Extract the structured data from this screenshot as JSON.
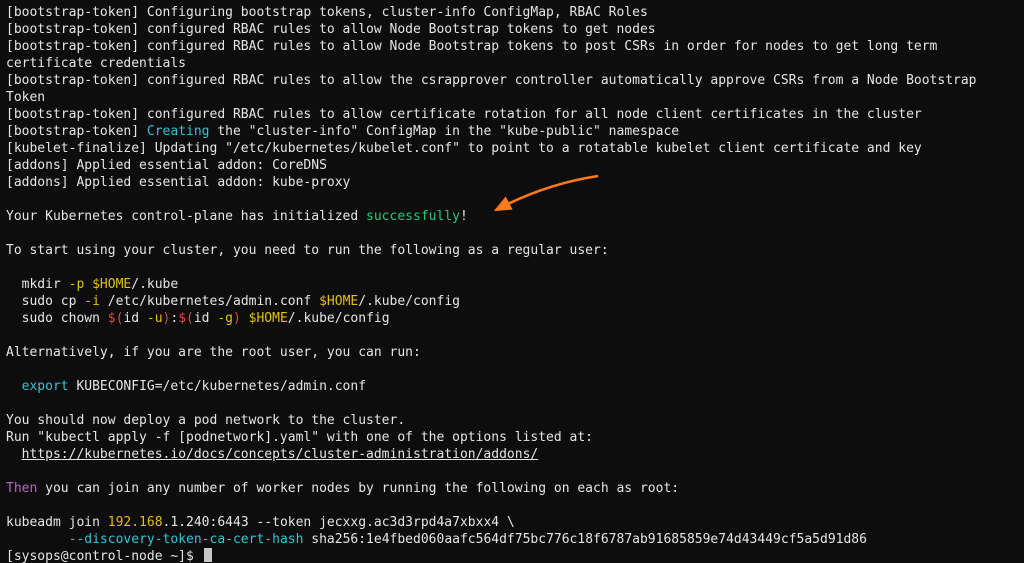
{
  "lines": [
    {
      "segments": [
        {
          "text": "[bootstrap-token] Configuring bootstrap tokens, cluster-info ConfigMap, RBAC Roles",
          "cls": "white"
        }
      ]
    },
    {
      "segments": [
        {
          "text": "[bootstrap-token] configured RBAC rules to allow Node Bootstrap tokens to get nodes",
          "cls": "white"
        }
      ]
    },
    {
      "segments": [
        {
          "text": "[bootstrap-token] configured RBAC rules to allow Node Bootstrap tokens to post CSRs in order for nodes to get long term certificate credentials",
          "cls": "white"
        }
      ]
    },
    {
      "segments": [
        {
          "text": "[bootstrap-token] configured RBAC rules to allow the csrapprover controller automatically approve CSRs from a Node Bootstrap Token",
          "cls": "white"
        }
      ]
    },
    {
      "segments": [
        {
          "text": "[bootstrap-token] configured RBAC rules to allow certificate rotation for all node client certificates in the cluster",
          "cls": "white"
        }
      ]
    },
    {
      "segments": [
        {
          "text": "[bootstrap-token] ",
          "cls": "white"
        },
        {
          "text": "Creating",
          "cls": "cyan"
        },
        {
          "text": " the \"cluster-info\" ConfigMap in the \"kube-public\" namespace",
          "cls": "white"
        }
      ]
    },
    {
      "segments": [
        {
          "text": "[kubelet-finalize] Updating \"/etc/kubernetes/kubelet.conf\" to point to a rotatable kubelet client certificate and key",
          "cls": "white"
        }
      ]
    },
    {
      "segments": [
        {
          "text": "[addons] Applied essential addon: CoreDNS",
          "cls": "white"
        }
      ]
    },
    {
      "segments": [
        {
          "text": "[addons] Applied essential addon: kube-proxy",
          "cls": "white"
        }
      ]
    },
    {
      "blank": true
    },
    {
      "segments": [
        {
          "text": "Your Kubernetes control-plane has initialized ",
          "cls": "white"
        },
        {
          "text": "successfully",
          "cls": "green"
        },
        {
          "text": "!",
          "cls": "white"
        }
      ]
    },
    {
      "blank": true
    },
    {
      "segments": [
        {
          "text": "To start using your cluster, you need to run the following as a regular user:",
          "cls": "white"
        }
      ]
    },
    {
      "blank": true
    },
    {
      "segments": [
        {
          "text": "  mkdir ",
          "cls": "white"
        },
        {
          "text": "-p",
          "cls": "yellow"
        },
        {
          "text": " ",
          "cls": "white"
        },
        {
          "text": "$HOME",
          "cls": "yellow"
        },
        {
          "text": "/.kube",
          "cls": "white"
        }
      ]
    },
    {
      "segments": [
        {
          "text": "  sudo cp ",
          "cls": "white"
        },
        {
          "text": "-i",
          "cls": "yellow"
        },
        {
          "text": " /etc/kubernetes/admin.conf ",
          "cls": "white"
        },
        {
          "text": "$HOME",
          "cls": "yellow"
        },
        {
          "text": "/.kube/config",
          "cls": "white"
        }
      ]
    },
    {
      "segments": [
        {
          "text": "  sudo chown ",
          "cls": "white"
        },
        {
          "text": "$(",
          "cls": "red"
        },
        {
          "text": "id ",
          "cls": "white"
        },
        {
          "text": "-u",
          "cls": "yellow"
        },
        {
          "text": ")",
          "cls": "red"
        },
        {
          "text": ":",
          "cls": "white"
        },
        {
          "text": "$(",
          "cls": "red"
        },
        {
          "text": "id ",
          "cls": "white"
        },
        {
          "text": "-g",
          "cls": "yellow"
        },
        {
          "text": ")",
          "cls": "red"
        },
        {
          "text": " ",
          "cls": "white"
        },
        {
          "text": "$HOME",
          "cls": "yellow"
        },
        {
          "text": "/.kube/config",
          "cls": "white"
        }
      ]
    },
    {
      "blank": true
    },
    {
      "segments": [
        {
          "text": "Alternatively, if you are the root user, you can run:",
          "cls": "white"
        }
      ]
    },
    {
      "blank": true
    },
    {
      "segments": [
        {
          "text": "  ",
          "cls": "white"
        },
        {
          "text": "export",
          "cls": "cyan"
        },
        {
          "text": " KUBECONFIG=/etc/kubernetes/admin.conf",
          "cls": "white"
        }
      ]
    },
    {
      "blank": true
    },
    {
      "segments": [
        {
          "text": "You should now deploy a pod network to the cluster.",
          "cls": "white"
        }
      ]
    },
    {
      "segments": [
        {
          "text": "Run \"kubectl apply -f [podnetwork].yaml\" with one of the options listed at:",
          "cls": "white"
        }
      ]
    },
    {
      "segments": [
        {
          "text": "  ",
          "cls": "white"
        },
        {
          "text": "https://kubernetes.io/docs/concepts/cluster-administration/addons/",
          "cls": "white under"
        }
      ]
    },
    {
      "blank": true
    },
    {
      "segments": [
        {
          "text": "Then",
          "cls": "magenta"
        },
        {
          "text": " you can join any number of worker nodes by running the following on each as root:",
          "cls": "white"
        }
      ]
    },
    {
      "blank": true
    },
    {
      "segments": [
        {
          "text": "kubeadm join ",
          "cls": "white"
        },
        {
          "text": "192.168",
          "cls": "yellow"
        },
        {
          "text": ".1.240:6443 --token jecxxg.ac3d3rpd4a7xbxx4 \\",
          "cls": "white"
        }
      ]
    },
    {
      "segments": [
        {
          "text": "        ",
          "cls": "white"
        },
        {
          "text": "--discovery-token-ca-cert-hash",
          "cls": "cyan"
        },
        {
          "text": " sha256:1e4fbed060aafc564df75bc776c18f6787ab91685859e74d43449cf5a5d91d86",
          "cls": "white"
        }
      ]
    },
    {
      "prompt": true,
      "segments": [
        {
          "text": "[sysops@control-node ~]$ ",
          "cls": "white"
        }
      ]
    }
  ],
  "annotation": {
    "color": "#ff7b1a"
  }
}
